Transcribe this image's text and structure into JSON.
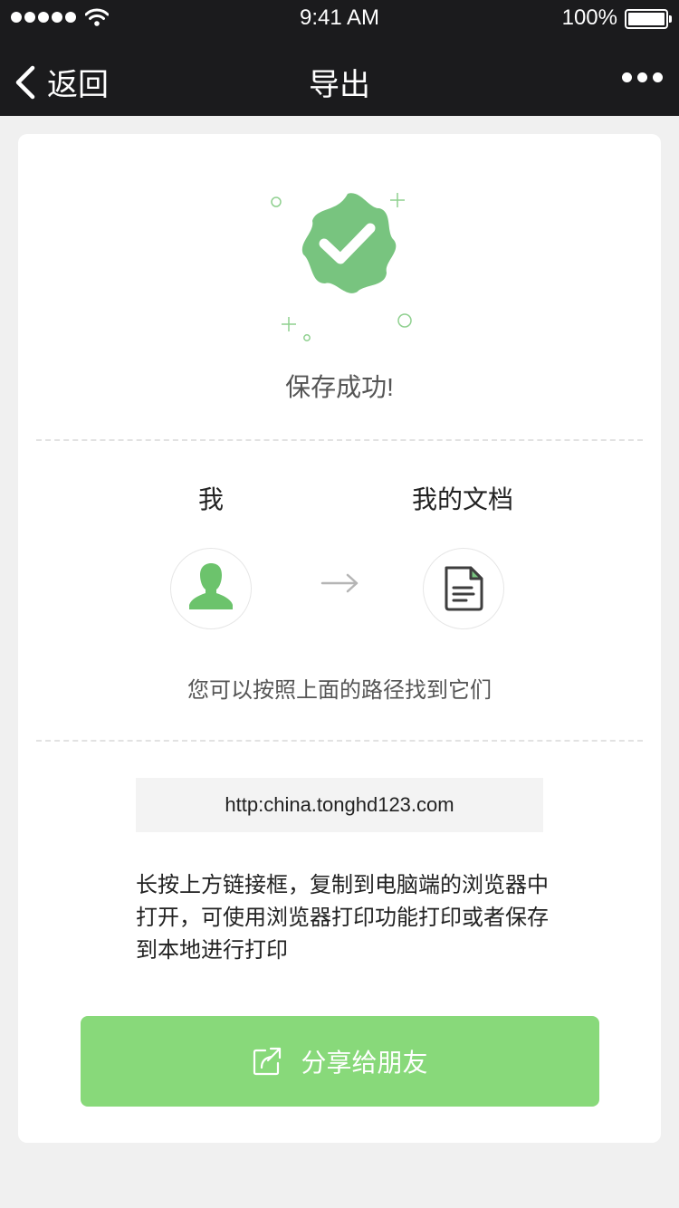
{
  "status_bar": {
    "time": "9:41 AM",
    "battery": "100%"
  },
  "nav": {
    "back_label": "返回",
    "title": "导出"
  },
  "success": {
    "message": "保存成功!",
    "badge_color": "#78c47f"
  },
  "path": {
    "from_label": "我",
    "to_label": "我的文档",
    "hint": "您可以按照上面的路径找到它们"
  },
  "link": {
    "url": "http:china.tonghd123.com"
  },
  "instructions": "长按上方链接框，复制到电脑端的浏览器中打开，可使用浏览器打印功能打印或者保存到本地进行打印",
  "share_button": {
    "label": "分享给朋友",
    "color": "#88d97a"
  },
  "icons": [
    "signal-icon",
    "wifi-icon",
    "battery-icon",
    "back-icon",
    "more-icon",
    "success-badge-icon",
    "user-icon",
    "arrow-right-icon",
    "document-icon",
    "share-icon"
  ]
}
